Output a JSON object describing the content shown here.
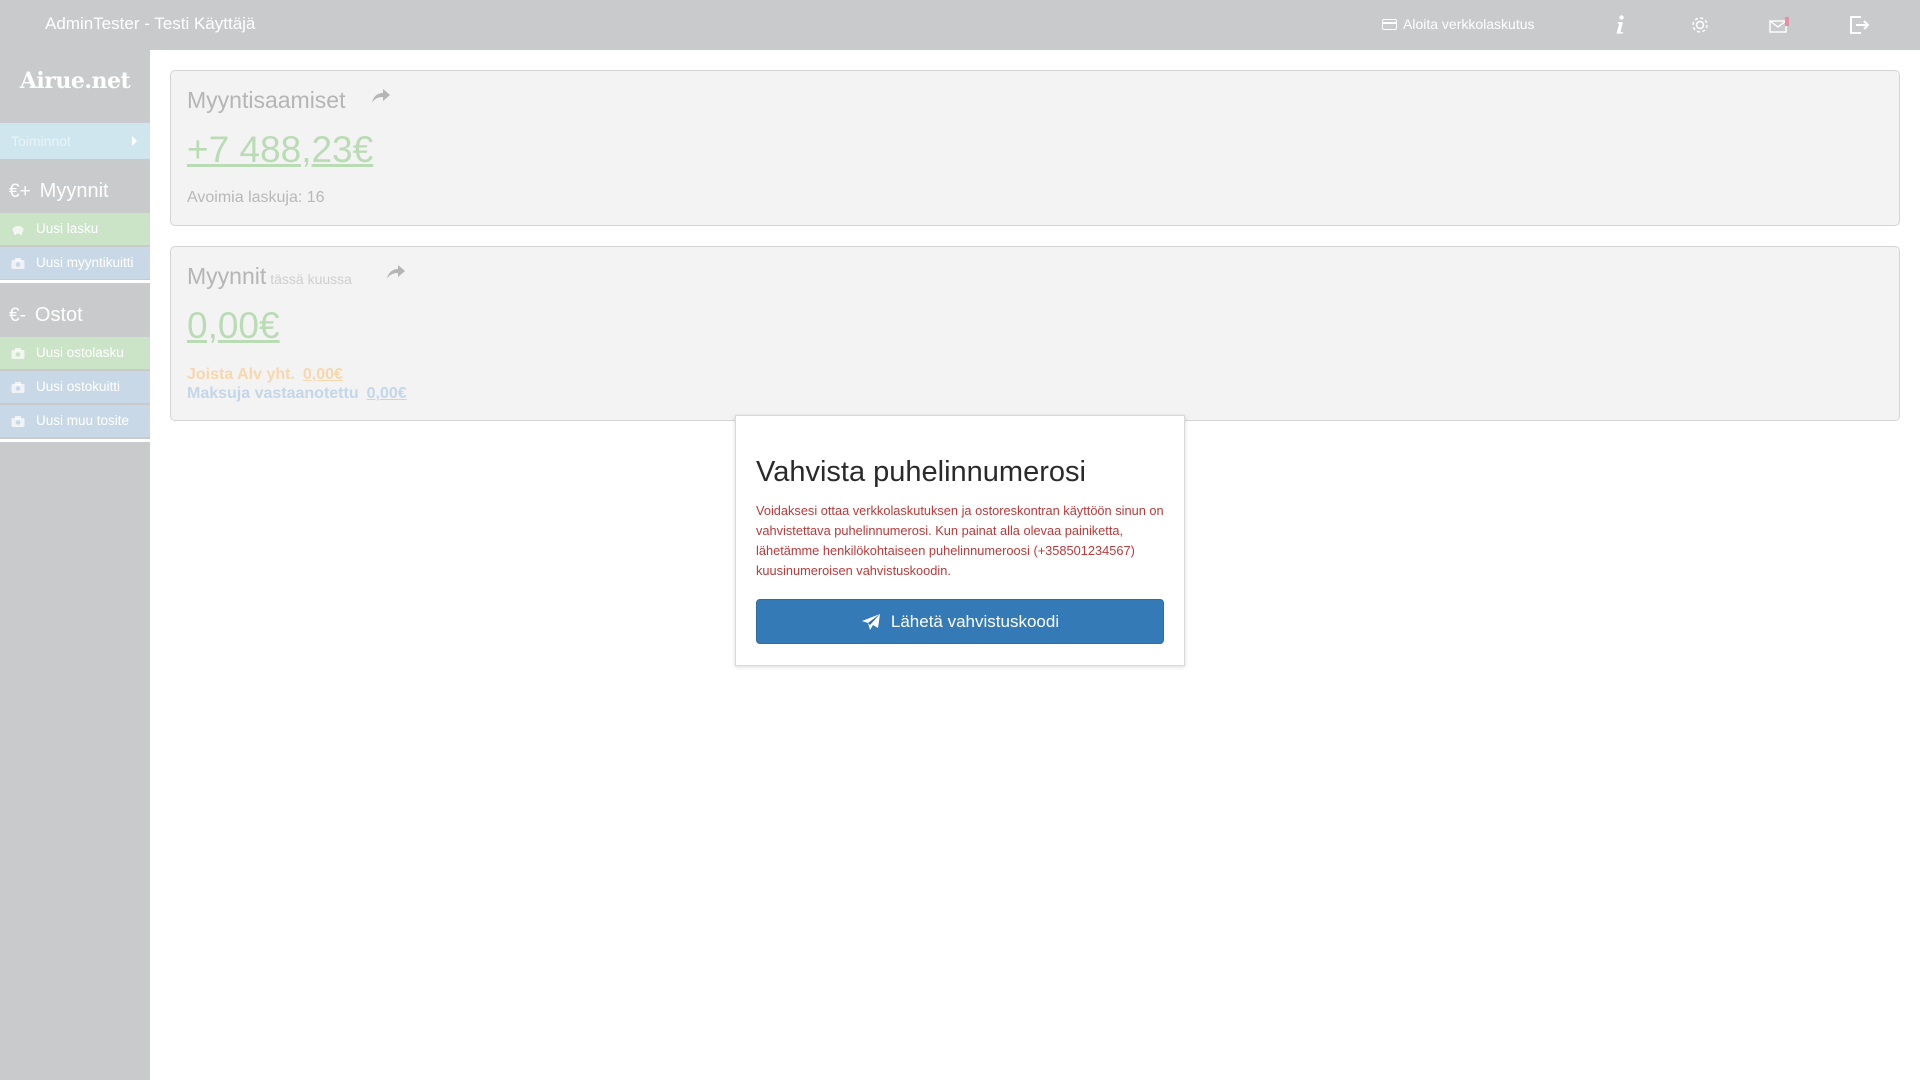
{
  "header": {
    "user_title": "AdminTester - Testi Käyttäjä",
    "einvoice_label": "Aloita verkkolaskutus",
    "icons": [
      "info-icon",
      "gear-icon",
      "mail-icon",
      "logout-icon"
    ]
  },
  "sidebar": {
    "logo": "Airue.net",
    "actions_label": "Toiminnot",
    "sales_section": {
      "symbol": "€+",
      "label": "Myynnit"
    },
    "sales_items": [
      {
        "label": "Uusi lasku",
        "icon": "piggy-bank-icon"
      },
      {
        "label": "Uusi myyntikuitti",
        "icon": "camera-icon"
      }
    ],
    "purchases_section": {
      "symbol": "€-",
      "label": "Ostot"
    },
    "purchase_items": [
      {
        "label": "Uusi ostolasku",
        "icon": "camera-icon"
      },
      {
        "label": "Uusi ostokuitti",
        "icon": "camera-icon"
      },
      {
        "label": "Uusi muu tosite",
        "icon": "camera-icon"
      }
    ]
  },
  "receivables": {
    "title": "Myyntisaamiset",
    "amount": "+7 488,23€",
    "open_invoices": "Avoimia laskuja: 16"
  },
  "sales": {
    "title": "Myynnit",
    "subtitle": "tässä kuussa",
    "amount": "0,00€",
    "vat_label": "Joista Alv yht.",
    "vat_value": "0,00€",
    "payments_label": "Maksuja vastaanotettu",
    "payments_value": "0,00€"
  },
  "modal": {
    "title": "Vahvista puhelinnumerosi",
    "text": "Voidaksesi ottaa verkkolaskutuksen ja ostoreskontran käyttöön sinun on vahvistettava puhelinnumerosi. Kun painat alla olevaa painiketta, lähetämme henkilökohtaiseen puhelinnumeroosi (+358501234567) kuusinumeroisen vahvistuskoodin.",
    "button_label": "Lähetä vahvistuskoodi"
  },
  "colors": {
    "topbar": "#c9cacc",
    "primary_button": "#337ab7",
    "warning_text": "#b93a3a",
    "sales_green": "#b9dcb5"
  }
}
